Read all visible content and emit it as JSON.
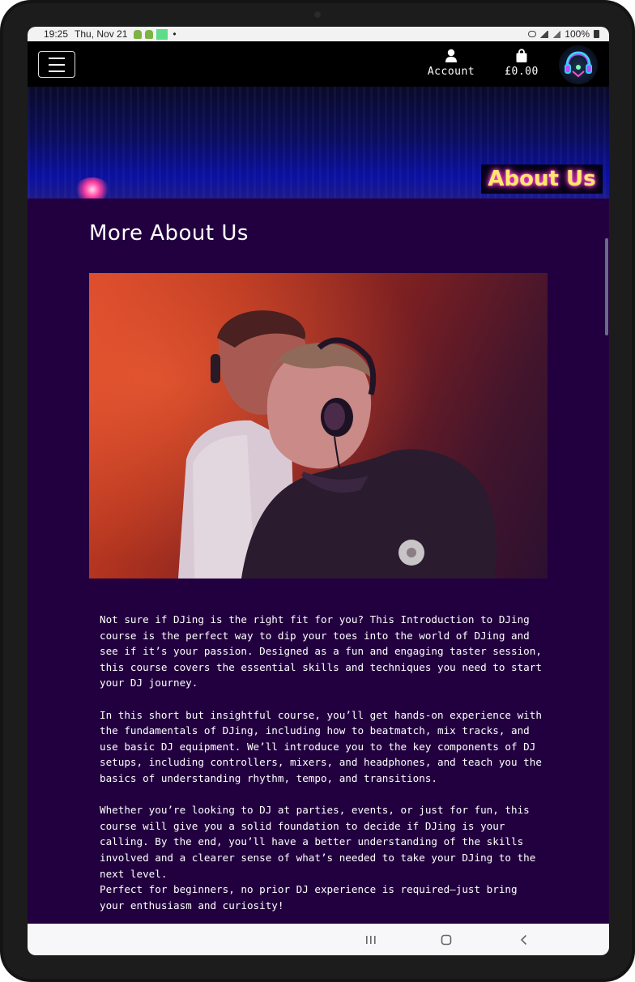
{
  "status_bar": {
    "time": "19:25",
    "date": "Thu, Nov 21",
    "dot": "•",
    "battery": "100%"
  },
  "navbar": {
    "account_label": "Account",
    "cart_total": "£0.00",
    "icons": {
      "menu": "hamburger-menu-icon",
      "account": "user-icon",
      "cart": "shopping-bag-icon",
      "logo": "dj-headphones-logo"
    }
  },
  "hero": {
    "title": "About Us"
  },
  "main": {
    "heading": "More About Us",
    "paragraphs": [
      "Not sure if DJing is the right fit for you? This Introduction to DJing course is the perfect way to dip your toes into the world of DJing and see if it’s your passion. Designed as a fun and engaging taster session, this course covers the essential skills and techniques you need to start your DJ journey.",
      "In this short but insightful course, you’ll get hands-on experience with the fundamentals of DJing, including how to beatmatch, mix tracks, and use basic DJ equipment. We’ll introduce you to the key components of DJ setups, including controllers, mixers, and headphones, and teach you the basics of understanding rhythm, tempo, and transitions.",
      "Whether you’re looking to DJ at parties, events, or just for fun, this course will give you a solid foundation to decide if DJing is your calling. By the end, you’ll have a better understanding of the skills involved and a clearer sense of what’s needed to take your DJing to the next level.",
      "Perfect for beginners, no prior DJ experience is required—just bring your enthusiasm and curiosity!"
    ]
  },
  "colors": {
    "page_bg": "#22003f",
    "navbar_bg": "#000000",
    "hero_title_text": "#ffe96a",
    "hero_title_glow": "#ff3ad0"
  }
}
